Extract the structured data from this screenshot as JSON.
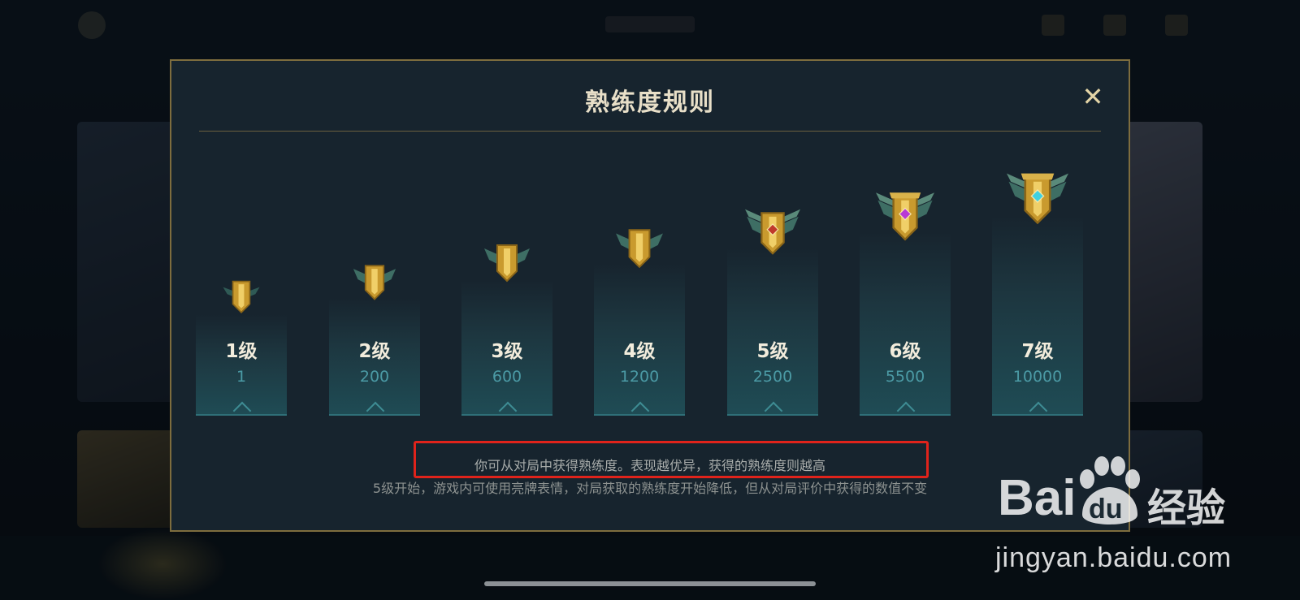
{
  "modal": {
    "title": "熟练度规则",
    "close_label": "✕",
    "levels": [
      {
        "label": "1级",
        "value": "1",
        "gem": ""
      },
      {
        "label": "2级",
        "value": "200",
        "gem": ""
      },
      {
        "label": "3级",
        "value": "600",
        "gem": ""
      },
      {
        "label": "4级",
        "value": "1200",
        "gem": ""
      },
      {
        "label": "5级",
        "value": "2500",
        "gem": "#c0392b"
      },
      {
        "label": "6级",
        "value": "5500",
        "gem": "#b83ad6"
      },
      {
        "label": "7级",
        "value": "10000",
        "gem": "#3fd0e0"
      }
    ],
    "note_highlighted": "你可从对局中获得熟练度。表现越优异，获得的熟练度则越高",
    "note_secondary": "5级开始，游戏内可使用亮牌表情，对局获取的熟练度开始降低，但从对局评价中获得的数值不变"
  },
  "watermark": {
    "brand_left": "Bai",
    "brand_right": "du",
    "brand_suffix": "经验",
    "url": "jingyan.baidu.com"
  },
  "colors": {
    "highlight_border": "#e0231b",
    "modal_border": "#7e6d3e",
    "level_value": "#4b9aa5"
  }
}
